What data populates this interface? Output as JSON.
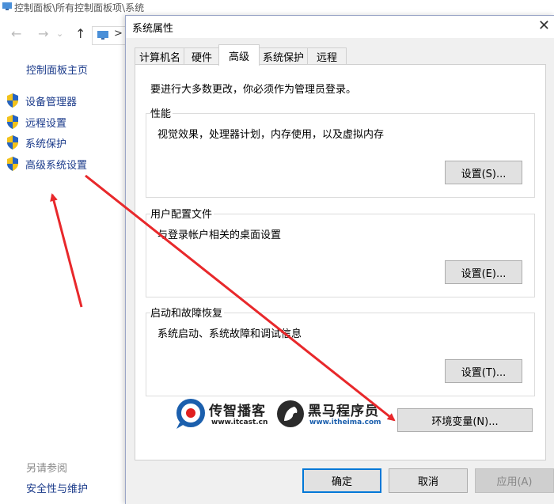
{
  "background_window": {
    "title": "控制面板\\所有控制面板项\\系统",
    "nav": {
      "back": "←",
      "forward": "→",
      "up": "↑",
      "sep": ">"
    },
    "sidebar": {
      "home": "控制面板主页",
      "items": [
        {
          "label": "设备管理器",
          "icon": "uac-shield-icon"
        },
        {
          "label": "远程设置",
          "icon": "uac-shield-icon"
        },
        {
          "label": "系统保护",
          "icon": "uac-shield-icon"
        },
        {
          "label": "高级系统设置",
          "icon": "uac-shield-icon"
        }
      ],
      "see_also": "另请参阅",
      "security_link": "安全性与维护"
    }
  },
  "dialog": {
    "title": "系统属性",
    "close": "✕",
    "tabs": [
      {
        "label": "计算机名",
        "active": false
      },
      {
        "label": "硬件",
        "active": false
      },
      {
        "label": "高级",
        "active": true
      },
      {
        "label": "系统保护",
        "active": false
      },
      {
        "label": "远程",
        "active": false
      }
    ],
    "admin_note": "要进行大多数更改，你必须作为管理员登录。",
    "groups": {
      "performance": {
        "title": "性能",
        "desc": "视觉效果，处理器计划，内存使用，以及虚拟内存",
        "button": "设置(S)..."
      },
      "user_profiles": {
        "title": "用户配置文件",
        "desc": "与登录帐户相关的桌面设置",
        "button": "设置(E)..."
      },
      "startup_recovery": {
        "title": "启动和故障恢复",
        "desc": "系统启动、系统故障和调试信息",
        "button": "设置(T)..."
      }
    },
    "env_button": "环境变量(N)...",
    "ok": "确定",
    "cancel": "取消",
    "apply": "应用(A)"
  },
  "watermark": {
    "logo1_name": "传智播客",
    "logo1_url": "www.itcast.cn",
    "logo2_name": "黑马程序员",
    "logo2_url": "www.itheima.com"
  },
  "colors": {
    "link": "#1a3a8a",
    "arrow": "#e8282b",
    "accent": "#0078d7",
    "brand_blue": "#1b5fad",
    "brand_red": "#e02020"
  }
}
